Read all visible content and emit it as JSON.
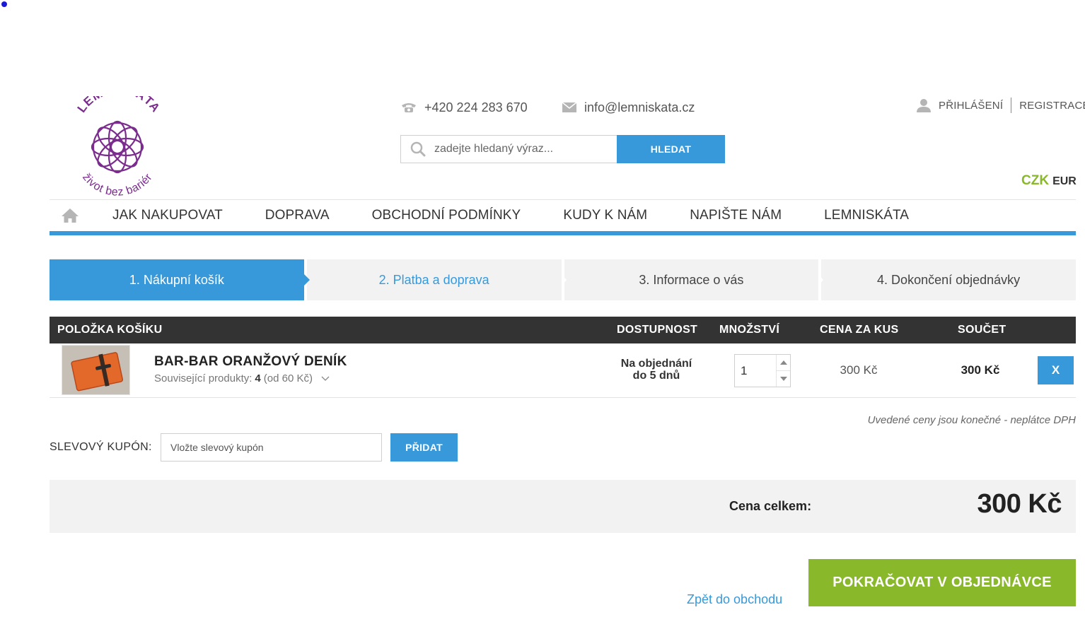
{
  "header": {
    "logo": {
      "top_text": "LEMNISKÁTA",
      "bottom_text": "život bez bariér",
      "color": "#7b2d8e"
    },
    "phone": "+420 224 283 670",
    "email": "info@lemniskata.cz",
    "login": "PŘIHLÁŠENÍ",
    "register": "REGISTRACE",
    "search": {
      "placeholder": "zadejte hledaný výraz...",
      "button": "HLEDAT"
    },
    "currency": {
      "active": "CZK",
      "other": "EUR"
    }
  },
  "nav": {
    "items": [
      "JAK NAKUPOVAT",
      "DOPRAVA",
      "OBCHODNÍ PODMÍNKY",
      "KUDY K NÁM",
      "NAPIŠTE NÁM",
      "LEMNISKÁTA"
    ]
  },
  "steps": [
    {
      "label": "1. Nákupní košík"
    },
    {
      "label": "2. Platba a doprava"
    },
    {
      "label": "3. Informace o vás"
    },
    {
      "label": "4. Dokončení objednávky"
    }
  ],
  "cart": {
    "headers": {
      "item": "POLOŽKA KOŠÍKU",
      "availability": "DOSTUPNOST",
      "quantity": "MNOŽSTVÍ",
      "unit_price": "CENA ZA KUS",
      "total": "SOUČET"
    },
    "rows": [
      {
        "name": "BAR-BAR ORANŽOVÝ DENÍK",
        "related_label": "Související produkty:",
        "related_count": "4",
        "related_from": "(od 60 Kč)",
        "availability_line1": "Na objednání",
        "availability_line2": "do 5 dnů",
        "quantity": "1",
        "unit_price": "300 Kč",
        "total": "300 Kč",
        "remove": "X"
      }
    ],
    "vat_note": "Uvedené ceny jsou konečné - neplátce DPH"
  },
  "coupon": {
    "label": "SLEVOVÝ KUPÓN:",
    "placeholder": "Vložte slevový kupón",
    "button": "PŘIDAT"
  },
  "summary": {
    "label": "Cena celkem:",
    "value": "300 Kč"
  },
  "actions": {
    "back": "Zpět do obchodu",
    "continue": "POKRAČOVAT V OBJEDNÁVCE"
  },
  "colors": {
    "accent_blue": "#3899da",
    "accent_green": "#8ab82b",
    "header_dark": "#333333"
  }
}
